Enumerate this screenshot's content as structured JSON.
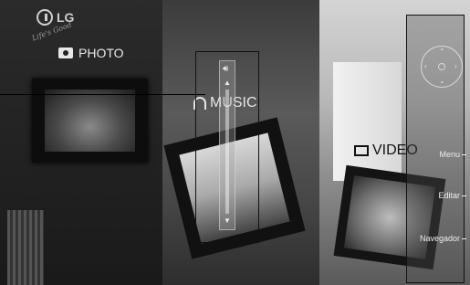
{
  "brand": {
    "logo_text": "LG",
    "tagline": "Life's Good"
  },
  "menu": {
    "photo": "PHOTO",
    "music": "MUSIC",
    "video": "VIDEO"
  },
  "volume": {
    "level": 1.0
  },
  "nav": {
    "menu_label": "Menu",
    "edit_label": "Editar",
    "navigator_label": "Navegador"
  }
}
